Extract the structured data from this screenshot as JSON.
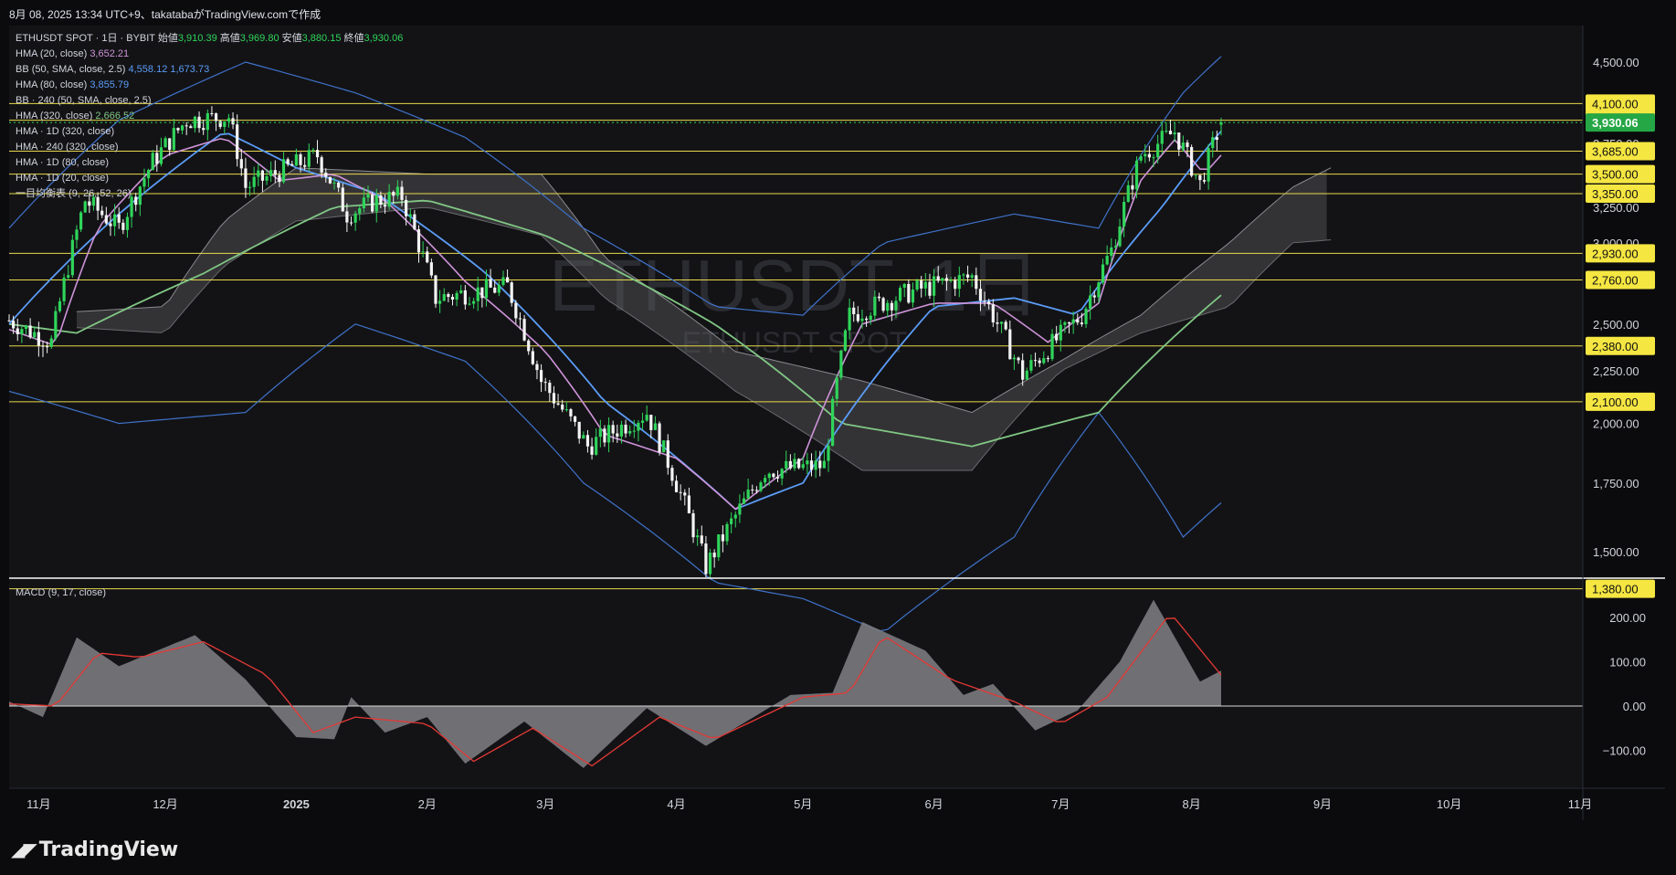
{
  "header": {
    "caption": "8月 08, 2025 13:34 UTC+9、takatabaがTradingView.comで作成"
  },
  "brand": {
    "name": "TradingView"
  },
  "chart_data": {
    "type": "candlestick",
    "watermark": {
      "title": "ETHUSDT, 1日",
      "subtitle": "ETHUSDT SPOT"
    },
    "legend": {
      "symbol_line": {
        "symbol": "ETHUSDT SPOT · 1日 · BYBIT",
        "open_label": "始値",
        "open": "3,910.39",
        "high_label": "高値",
        "high": "3,969.80",
        "low_label": "安値",
        "low": "3,880.15",
        "close_label": "終値",
        "close": "3,930.06"
      },
      "indicators": [
        {
          "label": "HMA (20, close)",
          "value": "3,652.21",
          "color": "#ce93d8"
        },
        {
          "label": "BB (50, SMA, close, 2.5)",
          "value": "4,558.12  1,673.73",
          "color": "#5b9cf6"
        },
        {
          "label": "HMA (80, close)",
          "value": "3,855.79",
          "color": "#5b9cf6"
        },
        {
          "label": "BB · 240 (50, SMA, close, 2.5)",
          "value": "",
          "color": "#d1d4dc"
        },
        {
          "label": "HMA (320, close)",
          "value": "2,666.52",
          "color": "#81c784"
        },
        {
          "label": "HMA · 1D (320, close)",
          "value": "",
          "color": "#d1d4dc"
        },
        {
          "label": "HMA · 240 (320, close)",
          "value": "",
          "color": "#d1d4dc"
        },
        {
          "label": "HMA · 1D (80, close)",
          "value": "",
          "color": "#d1d4dc"
        },
        {
          "label": "HMA · 1D (20, close)",
          "value": "",
          "color": "#d1d4dc"
        },
        {
          "label": "一目均衡表 (9, 26, 52, 26)",
          "value": "",
          "color": "#d1d4dc"
        }
      ]
    },
    "price_axis": {
      "ticks": [
        "4,500.00",
        "4,000.00",
        "3,750.00",
        "3,250.00",
        "3,000.00",
        "2,500.00",
        "2,250.00",
        "2,000.00",
        "1,750.00",
        "1,500.00"
      ],
      "tick_values": [
        4500,
        4000,
        3750,
        3250,
        3000,
        2500,
        2250,
        2000,
        1750,
        1500
      ],
      "current_price": "3,930.06",
      "current_value": 3930.06,
      "scale": "log"
    },
    "horizontal_levels": [
      {
        "label": "4,100.00",
        "value": 4100
      },
      {
        "label": "3,950.00",
        "value": 3950
      },
      {
        "label": "3,685.00",
        "value": 3685
      },
      {
        "label": "3,500.00",
        "value": 3500
      },
      {
        "label": "3,350.00",
        "value": 3350
      },
      {
        "label": "2,930.00",
        "value": 2930
      },
      {
        "label": "2,760.00",
        "value": 2760
      },
      {
        "label": "2,380.00",
        "value": 2380
      },
      {
        "label": "2,100.00",
        "value": 2100
      },
      {
        "label": "1,380.00",
        "value": 1380
      }
    ],
    "time_axis": {
      "labels": [
        "11月",
        "12月",
        "2025",
        "2月",
        "3月",
        "4月",
        "5月",
        "6月",
        "7月",
        "8月",
        "9月",
        "10月",
        "11月"
      ],
      "dates": [
        "2024-11-01",
        "2024-12-01",
        "2025-01-01",
        "2025-02-01",
        "2025-03-01",
        "2025-04-01",
        "2025-05-01",
        "2025-06-01",
        "2025-07-01",
        "2025-08-01",
        "2025-09-01",
        "2025-10-01",
        "2025-11-01"
      ],
      "range": [
        "2024-10-25",
        "2025-11-01"
      ]
    },
    "price_keypoints": [
      [
        "2024-10-25",
        2520
      ],
      [
        "2024-11-04",
        2400
      ],
      [
        "2024-11-12",
        3300
      ],
      [
        "2024-11-20",
        3100
      ],
      [
        "2024-11-28",
        3600
      ],
      [
        "2024-12-06",
        3950
      ],
      [
        "2024-12-16",
        3980
      ],
      [
        "2024-12-20",
        3400
      ],
      [
        "2025-01-06",
        3650
      ],
      [
        "2025-01-13",
        3200
      ],
      [
        "2025-01-20",
        3300
      ],
      [
        "2025-01-26",
        3330
      ],
      [
        "2025-02-03",
        2650
      ],
      [
        "2025-02-20",
        2720
      ],
      [
        "2025-02-28",
        2200
      ],
      [
        "2025-03-11",
        1900
      ],
      [
        "2025-03-25",
        2050
      ],
      [
        "2025-04-08",
        1450
      ],
      [
        "2025-04-22",
        1800
      ],
      [
        "2025-05-06",
        1820
      ],
      [
        "2025-05-12",
        2550
      ],
      [
        "2025-05-28",
        2700
      ],
      [
        "2025-06-10",
        2780
      ],
      [
        "2025-06-22",
        2230
      ],
      [
        "2025-07-06",
        2550
      ],
      [
        "2025-07-13",
        2950
      ],
      [
        "2025-07-20",
        3650
      ],
      [
        "2025-07-28",
        3850
      ],
      [
        "2025-08-03",
        3420
      ],
      [
        "2025-08-08",
        3930
      ]
    ],
    "hma20_keypoints": [
      [
        "2024-10-25",
        2470
      ],
      [
        "2024-11-05",
        2380
      ],
      [
        "2024-11-15",
        3100
      ],
      [
        "2024-12-01",
        3650
      ],
      [
        "2024-12-15",
        3800
      ],
      [
        "2024-12-28",
        3450
      ],
      [
        "2025-01-10",
        3500
      ],
      [
        "2025-01-22",
        3300
      ],
      [
        "2025-02-10",
        2750
      ],
      [
        "2025-03-01",
        2350
      ],
      [
        "2025-03-15",
        1950
      ],
      [
        "2025-04-01",
        1850
      ],
      [
        "2025-04-15",
        1650
      ],
      [
        "2025-05-01",
        1850
      ],
      [
        "2025-05-15",
        2500
      ],
      [
        "2025-06-01",
        2620
      ],
      [
        "2025-06-15",
        2620
      ],
      [
        "2025-06-28",
        2400
      ],
      [
        "2025-07-10",
        2620
      ],
      [
        "2025-07-20",
        3450
      ],
      [
        "2025-07-28",
        3780
      ],
      [
        "2025-08-04",
        3500
      ],
      [
        "2025-08-08",
        3652
      ]
    ],
    "hma80_keypoints": [
      [
        "2024-10-25",
        2500
      ],
      [
        "2024-11-20",
        3200
      ],
      [
        "2024-12-15",
        3850
      ],
      [
        "2025-01-01",
        3550
      ],
      [
        "2025-01-20",
        3350
      ],
      [
        "2025-02-15",
        2800
      ],
      [
        "2025-03-15",
        2100
      ],
      [
        "2025-04-15",
        1650
      ],
      [
        "2025-05-01",
        1750
      ],
      [
        "2025-06-01",
        2600
      ],
      [
        "2025-06-20",
        2650
      ],
      [
        "2025-07-05",
        2550
      ],
      [
        "2025-07-25",
        3250
      ],
      [
        "2025-08-08",
        3856
      ]
    ],
    "hma320_keypoints": [
      [
        "2024-10-25",
        2500
      ],
      [
        "2024-11-10",
        2450
      ],
      [
        "2024-12-10",
        2800
      ],
      [
        "2025-01-10",
        3250
      ],
      [
        "2025-02-01",
        3300
      ],
      [
        "2025-03-01",
        3050
      ],
      [
        "2025-04-10",
        2500
      ],
      [
        "2025-05-10",
        2000
      ],
      [
        "2025-06-10",
        1900
      ],
      [
        "2025-07-10",
        2050
      ],
      [
        "2025-08-08",
        2667
      ]
    ],
    "bb_upper_keypoints": [
      [
        "2024-10-25",
        3100
      ],
      [
        "2024-11-20",
        3950
      ],
      [
        "2024-12-20",
        4500
      ],
      [
        "2025-01-15",
        4200
      ],
      [
        "2025-02-10",
        3800
      ],
      [
        "2025-03-10",
        3100
      ],
      [
        "2025-04-10",
        2600
      ],
      [
        "2025-05-01",
        2550
      ],
      [
        "2025-05-20",
        3000
      ],
      [
        "2025-06-20",
        3200
      ],
      [
        "2025-07-10",
        3100
      ],
      [
        "2025-07-30",
        4200
      ],
      [
        "2025-08-08",
        4558
      ]
    ],
    "bb_lower_keypoints": [
      [
        "2024-10-25",
        2150
      ],
      [
        "2024-11-20",
        2000
      ],
      [
        "2024-12-20",
        2050
      ],
      [
        "2025-01-15",
        2500
      ],
      [
        "2025-02-10",
        2300
      ],
      [
        "2025-03-10",
        1750
      ],
      [
        "2025-04-10",
        1400
      ],
      [
        "2025-05-01",
        1350
      ],
      [
        "2025-05-20",
        1250
      ],
      [
        "2025-06-20",
        1550
      ],
      [
        "2025-07-10",
        2050
      ],
      [
        "2025-07-30",
        1550
      ],
      [
        "2025-08-08",
        1674
      ]
    ],
    "cloud_top_keypoints": [
      [
        "2024-11-10",
        2570
      ],
      [
        "2024-12-01",
        2600
      ],
      [
        "2024-12-15",
        3150
      ],
      [
        "2025-01-01",
        3550
      ],
      [
        "2025-02-01",
        3500
      ],
      [
        "2025-02-28",
        3500
      ],
      [
        "2025-03-15",
        2900
      ],
      [
        "2025-04-15",
        2350
      ],
      [
        "2025-05-15",
        2200
      ],
      [
        "2025-06-10",
        2050
      ],
      [
        "2025-07-01",
        2300
      ],
      [
        "2025-07-20",
        2550
      ],
      [
        "2025-08-10",
        3000
      ],
      [
        "2025-08-25",
        3400
      ],
      [
        "2025-09-03",
        3550
      ]
    ],
    "cloud_bottom_keypoints": [
      [
        "2024-11-10",
        2480
      ],
      [
        "2024-12-01",
        2450
      ],
      [
        "2024-12-15",
        2850
      ],
      [
        "2025-01-01",
        3150
      ],
      [
        "2025-02-01",
        3250
      ],
      [
        "2025-02-28",
        3050
      ],
      [
        "2025-03-15",
        2650
      ],
      [
        "2025-04-15",
        2150
      ],
      [
        "2025-05-15",
        1800
      ],
      [
        "2025-06-10",
        1800
      ],
      [
        "2025-07-01",
        2250
      ],
      [
        "2025-07-20",
        2450
      ],
      [
        "2025-08-10",
        2600
      ],
      [
        "2025-08-25",
        3000
      ],
      [
        "2025-09-03",
        3020
      ]
    ],
    "macd": {
      "label": "MACD (9, 17, close)",
      "ticks": [
        "200.00",
        "100.00",
        "0.00",
        "−100.00"
      ],
      "tick_values": [
        200,
        100,
        0,
        -100
      ],
      "range": [
        -150,
        250
      ],
      "hist_keypoints": [
        [
          "2024-10-25",
          10
        ],
        [
          "2024-11-02",
          -25
        ],
        [
          "2024-11-10",
          155
        ],
        [
          "2024-11-20",
          90
        ],
        [
          "2024-12-08",
          160
        ],
        [
          "2024-12-20",
          60
        ],
        [
          "2025-01-01",
          -70
        ],
        [
          "2025-01-10",
          -75
        ],
        [
          "2025-01-14",
          20
        ],
        [
          "2025-01-22",
          -60
        ],
        [
          "2025-02-01",
          -25
        ],
        [
          "2025-02-10",
          -130
        ],
        [
          "2025-02-24",
          -35
        ],
        [
          "2025-03-10",
          -140
        ],
        [
          "2025-03-25",
          -5
        ],
        [
          "2025-04-08",
          -90
        ],
        [
          "2025-04-28",
          25
        ],
        [
          "2025-05-08",
          30
        ],
        [
          "2025-05-15",
          190
        ],
        [
          "2025-05-30",
          125
        ],
        [
          "2025-06-08",
          25
        ],
        [
          "2025-06-15",
          50
        ],
        [
          "2025-06-25",
          -55
        ],
        [
          "2025-07-05",
          -10
        ],
        [
          "2025-07-15",
          100
        ],
        [
          "2025-07-23",
          240
        ],
        [
          "2025-08-03",
          55
        ],
        [
          "2025-08-08",
          80
        ]
      ],
      "signal_keypoints": [
        [
          "2024-10-25",
          5
        ],
        [
          "2024-11-05",
          0
        ],
        [
          "2024-11-15",
          120
        ],
        [
          "2024-11-25",
          110
        ],
        [
          "2024-12-10",
          145
        ],
        [
          "2024-12-25",
          70
        ],
        [
          "2025-01-05",
          -60
        ],
        [
          "2025-01-15",
          -25
        ],
        [
          "2025-02-01",
          -40
        ],
        [
          "2025-02-12",
          -125
        ],
        [
          "2025-02-26",
          -50
        ],
        [
          "2025-03-12",
          -135
        ],
        [
          "2025-03-28",
          -25
        ],
        [
          "2025-04-10",
          -75
        ],
        [
          "2025-05-01",
          20
        ],
        [
          "2025-05-12",
          30
        ],
        [
          "2025-05-20",
          160
        ],
        [
          "2025-06-05",
          60
        ],
        [
          "2025-06-20",
          10
        ],
        [
          "2025-07-01",
          -40
        ],
        [
          "2025-07-12",
          20
        ],
        [
          "2025-07-27",
          210
        ],
        [
          "2025-08-08",
          70
        ]
      ]
    }
  }
}
